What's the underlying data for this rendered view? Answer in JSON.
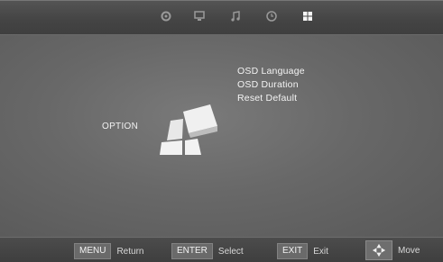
{
  "tabs": {
    "items": [
      {
        "icon": "gear-icon"
      },
      {
        "icon": "monitor-icon"
      },
      {
        "icon": "music-note-icon"
      },
      {
        "icon": "clock-icon"
      },
      {
        "icon": "option-grid-icon",
        "active": true
      }
    ]
  },
  "menu": {
    "title": "OPTION",
    "items": [
      {
        "label": "OSD Language"
      },
      {
        "label": "OSD Duration"
      },
      {
        "label": "Reset Default"
      }
    ]
  },
  "footer": {
    "menu": {
      "key": "MENU",
      "label": "Return"
    },
    "enter": {
      "key": "ENTER",
      "label": "Select"
    },
    "exit": {
      "key": "EXIT",
      "label": "Exit"
    },
    "move": {
      "label": "Move"
    }
  }
}
